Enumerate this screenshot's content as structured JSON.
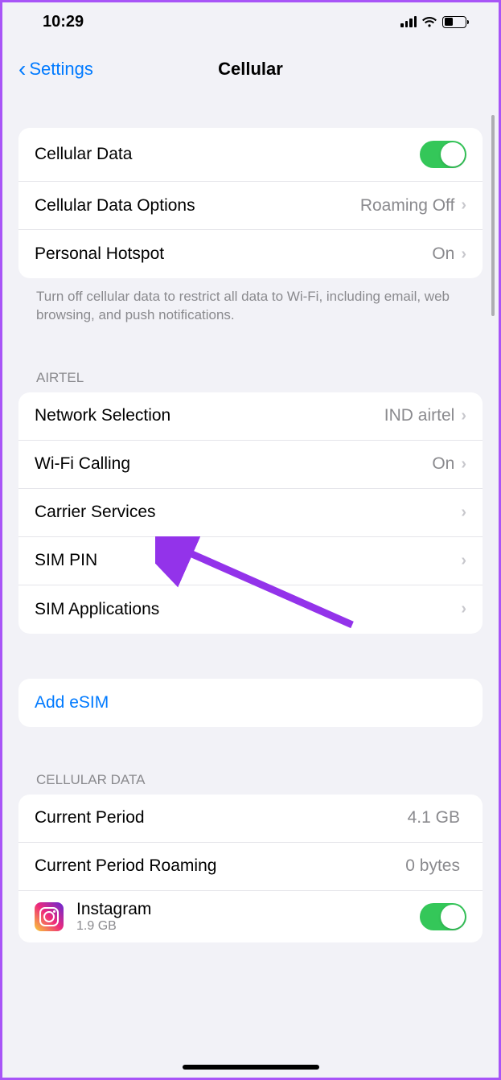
{
  "status": {
    "time": "10:29"
  },
  "nav": {
    "back_label": "Settings",
    "title": "Cellular"
  },
  "section1": {
    "rows": [
      {
        "label": "Cellular Data"
      },
      {
        "label": "Cellular Data Options",
        "value": "Roaming Off"
      },
      {
        "label": "Personal Hotspot",
        "value": "On"
      }
    ],
    "footer": "Turn off cellular data to restrict all data to Wi-Fi, including email, web browsing, and push notifications."
  },
  "section2": {
    "header": "AIRTEL",
    "rows": [
      {
        "label": "Network Selection",
        "value": "IND airtel"
      },
      {
        "label": "Wi-Fi Calling",
        "value": "On"
      },
      {
        "label": "Carrier Services"
      },
      {
        "label": "SIM PIN"
      },
      {
        "label": "SIM Applications"
      }
    ]
  },
  "section3": {
    "rows": [
      {
        "label": "Add eSIM"
      }
    ]
  },
  "section4": {
    "header": "CELLULAR DATA",
    "rows": [
      {
        "label": "Current Period",
        "value": "4.1 GB"
      },
      {
        "label": "Current Period Roaming",
        "value": "0 bytes"
      }
    ],
    "app": {
      "name": "Instagram",
      "size": "1.9 GB"
    }
  }
}
